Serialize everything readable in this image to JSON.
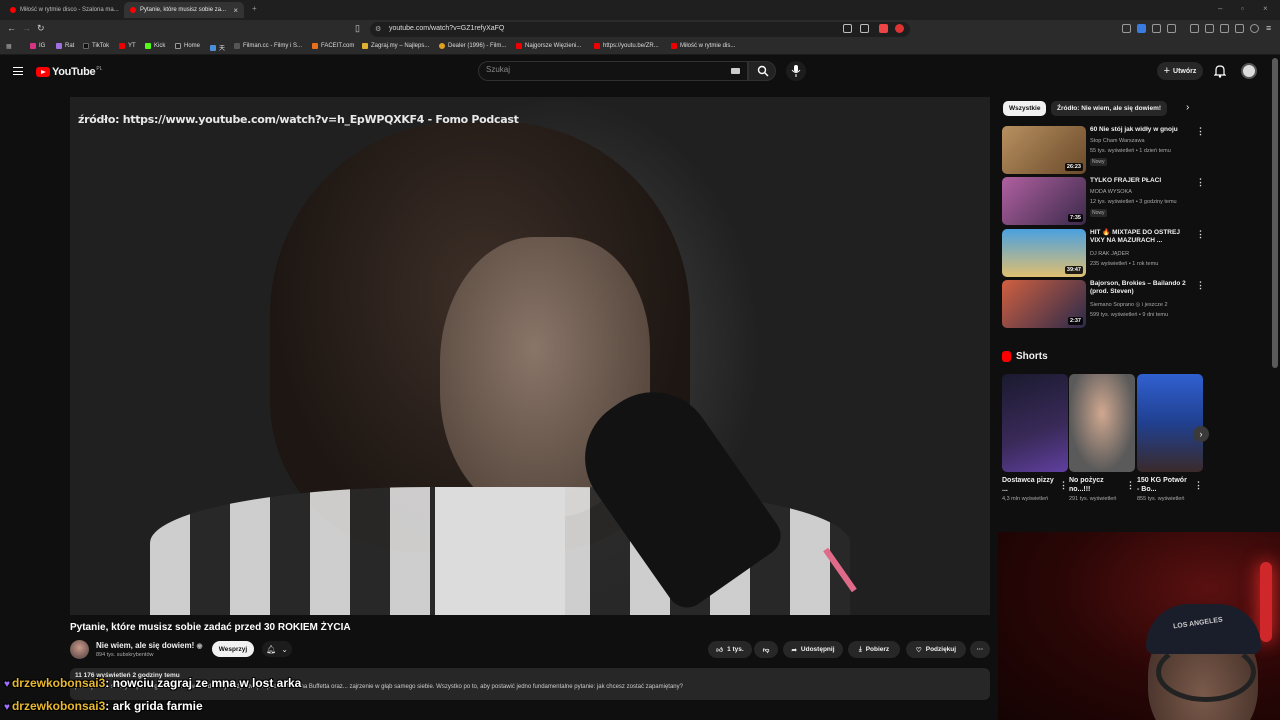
{
  "browser": {
    "tabs": [
      {
        "label": "Miłość w rytmie disco - Szalona ma..."
      },
      {
        "label": "Pytanie, które musisz sobie za...",
        "active": true
      }
    ],
    "url": "youtube.com/watch?v=GZ1refyXaFQ",
    "bookmarks": [
      "IG",
      "Rat",
      "TikTok",
      "YT",
      "Kick",
      "Home",
      "天",
      "Filman.cc - Filmy i S...",
      "FACEIT.com",
      "Zagraj.my – Najleps...",
      "Dealer (1996) - Film...",
      "Najgorsze Więzieni...",
      "https://youtu.be/ZR...",
      "Miłość w rytmie dis..."
    ]
  },
  "youtube": {
    "logo": "YouTube",
    "region": "PL",
    "search_placeholder": "Szukaj",
    "create_label": "Utwórz"
  },
  "video": {
    "overlay_source": "źródło: https://www.youtube.com/watch?v=h_EpWPQXKF4 - Fomo Podcast",
    "title": "Pytanie, które musisz sobie zadać przed 30 ROKIEM ŻYCIA",
    "channel": "Nie wiem, ale się dowiem!",
    "subscribers": "894 tys. subskrybentów",
    "support_label": "Wesprzyj",
    "likes": "1 tys.",
    "share_label": "Udostępnij",
    "download_label": "Pobierz",
    "thanks_label": "Podziękuj",
    "description_meta": "11 176 wyświetleń  2 godziny temu",
    "description_text": "poznaj różne światy - upadek gwiazd z filmów dla dorosłych, życiową mądrość Warrena Buffetta oraz... zajrzenie w głąb samego siebie. Wszystko po to, aby postawić jedno fundamentalne pytanie: jak chcesz zostać zapamiętany?"
  },
  "chat": [
    {
      "user": "drzewkobonsai3",
      "message": ": nowciu zagraj ze mna w lost arka",
      "heart": true
    },
    {
      "user": "drzewkobonsai3",
      "message": ": ark grida farmie",
      "heart": true
    }
  ],
  "sidebar": {
    "chips": [
      "Wszystkie",
      "Źródło: Nie wiem, ale się dowiem!"
    ],
    "recommendations": [
      {
        "title": "60 Nie stój jak widły w gnoju",
        "channel": "Stop Cham Warszawa",
        "stats": "55 tys. wyświetleń • 1 dzień temu",
        "badge": "Nowy",
        "duration": "26:23"
      },
      {
        "title": "TYLKO FRAJER PŁACI",
        "channel": "MODA WYSOKA",
        "stats": "12 tys. wyświetleń • 3 godziny temu",
        "badge": "Nowy",
        "duration": "7:35"
      },
      {
        "title": "HIT 🔥 MIXTAPE DO OSTREJ VIXY NA MAZURACH ...",
        "channel": "DJ RAK JĄDER",
        "stats": "235 wyświetleń • 1 rok temu",
        "badge": "",
        "duration": "39:47"
      },
      {
        "title": "Bajorson, Brokies – Bailando 2 (prod. Steven)",
        "channel": "Siemano Soprano ◎ i jeszcze 2",
        "stats": "599 tys. wyświetleń • 9 dni temu",
        "badge": "",
        "duration": "2:37"
      }
    ],
    "shorts_heading": "Shorts",
    "shorts": [
      {
        "title": "Dostawca pizzy ...",
        "views": "4,3 mln wyświetleń"
      },
      {
        "title": "No pożycz no...!!!",
        "views": "291 tys. wyświetleń"
      },
      {
        "title": "150 KG Potwór - Bo...",
        "views": "855 tys. wyświetleń"
      }
    ]
  },
  "webcam": {
    "cap_text": "LOS ANGELES"
  }
}
